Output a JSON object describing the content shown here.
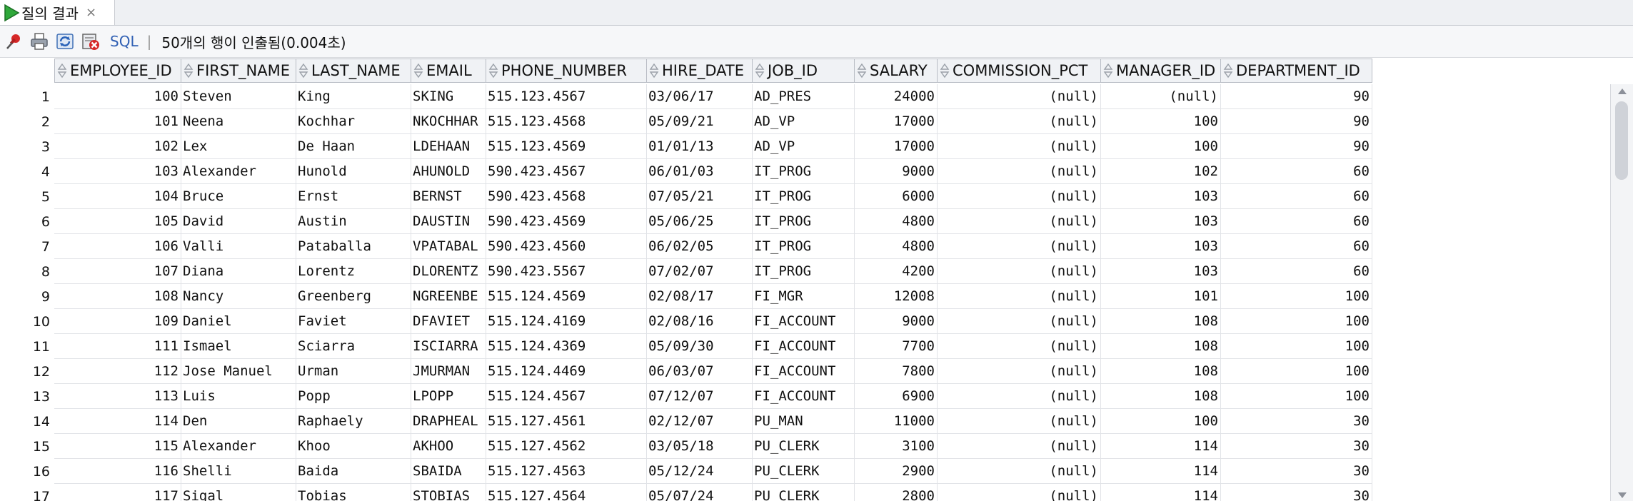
{
  "tab": {
    "title": "질의 결과",
    "close": "×"
  },
  "toolbar": {
    "icons": [
      "pin-icon",
      "print-icon",
      "refresh-icon",
      "cancel-query-icon"
    ],
    "sql_label": "SQL",
    "separator": "|",
    "status": "50개의 행이 인출됨(0.004초)"
  },
  "grid": {
    "columns": [
      "EMPLOYEE_ID",
      "FIRST_NAME",
      "LAST_NAME",
      "EMAIL",
      "PHONE_NUMBER",
      "HIRE_DATE",
      "JOB_ID",
      "SALARY",
      "COMMISSION_PCT",
      "MANAGER_ID",
      "DEPARTMENT_ID"
    ],
    "rows": [
      [
        "1",
        "100",
        "Steven",
        "King",
        "SKING",
        "515.123.4567",
        "03/06/17",
        "AD_PRES",
        "24000",
        "(null)",
        "(null)",
        "90"
      ],
      [
        "2",
        "101",
        "Neena",
        "Kochhar",
        "NKOCHHAR",
        "515.123.4568",
        "05/09/21",
        "AD_VP",
        "17000",
        "(null)",
        "100",
        "90"
      ],
      [
        "3",
        "102",
        "Lex",
        "De Haan",
        "LDEHAAN",
        "515.123.4569",
        "01/01/13",
        "AD_VP",
        "17000",
        "(null)",
        "100",
        "90"
      ],
      [
        "4",
        "103",
        "Alexander",
        "Hunold",
        "AHUNOLD",
        "590.423.4567",
        "06/01/03",
        "IT_PROG",
        "9000",
        "(null)",
        "102",
        "60"
      ],
      [
        "5",
        "104",
        "Bruce",
        "Ernst",
        "BERNST",
        "590.423.4568",
        "07/05/21",
        "IT_PROG",
        "6000",
        "(null)",
        "103",
        "60"
      ],
      [
        "6",
        "105",
        "David",
        "Austin",
        "DAUSTIN",
        "590.423.4569",
        "05/06/25",
        "IT_PROG",
        "4800",
        "(null)",
        "103",
        "60"
      ],
      [
        "7",
        "106",
        "Valli",
        "Pataballa",
        "VPATABAL",
        "590.423.4560",
        "06/02/05",
        "IT_PROG",
        "4800",
        "(null)",
        "103",
        "60"
      ],
      [
        "8",
        "107",
        "Diana",
        "Lorentz",
        "DLORENTZ",
        "590.423.5567",
        "07/02/07",
        "IT_PROG",
        "4200",
        "(null)",
        "103",
        "60"
      ],
      [
        "9",
        "108",
        "Nancy",
        "Greenberg",
        "NGREENBE",
        "515.124.4569",
        "02/08/17",
        "FI_MGR",
        "12008",
        "(null)",
        "101",
        "100"
      ],
      [
        "10",
        "109",
        "Daniel",
        "Faviet",
        "DFAVIET",
        "515.124.4169",
        "02/08/16",
        "FI_ACCOUNT",
        "9000",
        "(null)",
        "108",
        "100"
      ],
      [
        "11",
        "111",
        "Ismael",
        "Sciarra",
        "ISCIARRA",
        "515.124.4369",
        "05/09/30",
        "FI_ACCOUNT",
        "7700",
        "(null)",
        "108",
        "100"
      ],
      [
        "12",
        "112",
        "Jose Manuel",
        "Urman",
        "JMURMAN",
        "515.124.4469",
        "06/03/07",
        "FI_ACCOUNT",
        "7800",
        "(null)",
        "108",
        "100"
      ],
      [
        "13",
        "113",
        "Luis",
        "Popp",
        "LPOPP",
        "515.124.4567",
        "07/12/07",
        "FI_ACCOUNT",
        "6900",
        "(null)",
        "108",
        "100"
      ],
      [
        "14",
        "114",
        "Den",
        "Raphaely",
        "DRAPHEAL",
        "515.127.4561",
        "02/12/07",
        "PU_MAN",
        "11000",
        "(null)",
        "100",
        "30"
      ],
      [
        "15",
        "115",
        "Alexander",
        "Khoo",
        "AKHOO",
        "515.127.4562",
        "03/05/18",
        "PU_CLERK",
        "3100",
        "(null)",
        "114",
        "30"
      ],
      [
        "16",
        "116",
        "Shelli",
        "Baida",
        "SBAIDA",
        "515.127.4563",
        "05/12/24",
        "PU_CLERK",
        "2900",
        "(null)",
        "114",
        "30"
      ],
      [
        "17",
        "117",
        "Sigal",
        "Tobias",
        "STOBIAS",
        "515.127.4564",
        "05/07/24",
        "PU_CLERK",
        "2800",
        "(null)",
        "114",
        "30"
      ]
    ]
  },
  "scrollbar": {
    "up": "▲",
    "down": "▼"
  }
}
